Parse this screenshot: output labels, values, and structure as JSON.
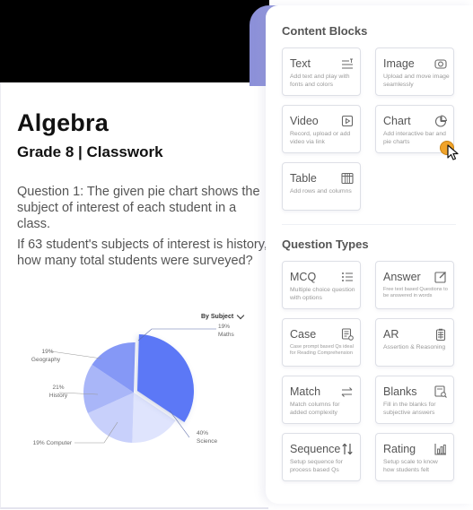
{
  "worksheet": {
    "title": "Algebra",
    "subtitle": "Grade 8 | Classwork",
    "question_intro": "Question 1: The given pie chart shows the subject of interest of each student in a class.",
    "question_prompt": "If 63 student's subjects of interest is history, how many total students were surveyed?",
    "chart_filter": {
      "label": "By Subject",
      "icon": "chevron-down-icon"
    }
  },
  "chart_data": {
    "type": "pie",
    "title": "",
    "legend": "none",
    "slices": [
      {
        "label": "Science",
        "value": 40,
        "display": "40%",
        "color": "#5b78f6"
      },
      {
        "label": "Computer",
        "value": 19,
        "display": "19% Computer",
        "color": "#dfe4fd"
      },
      {
        "label": "History",
        "value": 21,
        "display": "21%",
        "color": "#c8d0fb"
      },
      {
        "label": "Geography",
        "value": 19,
        "display": "19%",
        "color": "#a9b6f8"
      },
      {
        "label": "Maths",
        "value": 19,
        "display": "19%",
        "color": "#8598f6"
      }
    ]
  },
  "panel": {
    "content_blocks_title": "Content Blocks",
    "content_blocks": [
      {
        "name": "Text",
        "desc": "Add text and play with fonts and colors",
        "icon": "text-format-icon"
      },
      {
        "name": "Image",
        "desc": "Upload and move image seamlessly",
        "icon": "camera-icon"
      },
      {
        "name": "Video",
        "desc": "Record, upload or add video via link",
        "icon": "play-icon"
      },
      {
        "name": "Chart",
        "desc": "Add interactive bar and pie charts",
        "icon": "pie-chart-icon"
      },
      {
        "name": "Table",
        "desc": "Add rows and columns",
        "icon": "table-icon"
      }
    ],
    "question_types_title": "Question Types",
    "question_types": [
      {
        "name": "MCQ",
        "desc": "Multiple choice question with options",
        "icon": "list-icon"
      },
      {
        "name": "Answer",
        "desc": "Free text based Questions to be answered in words",
        "icon": "edit-icon"
      },
      {
        "name": "Case",
        "desc": "Case prompt based Qs ideal for Reading Comprehension",
        "icon": "document-check-icon"
      },
      {
        "name": "AR",
        "desc": "Assertion & Reasoning",
        "icon": "clipboard-icon"
      },
      {
        "name": "Match",
        "desc": "Match columns for added complexity",
        "icon": "swap-arrows-icon"
      },
      {
        "name": "Blanks",
        "desc": "Fill in the blanks for subjective answers",
        "icon": "document-search-icon"
      },
      {
        "name": "Sequence",
        "desc": "Setup sequence for process based Qs",
        "icon": "sort-arrows-icon"
      },
      {
        "name": "Rating",
        "desc": "Setup scale to know how students felt",
        "icon": "bar-chart-icon"
      }
    ]
  }
}
